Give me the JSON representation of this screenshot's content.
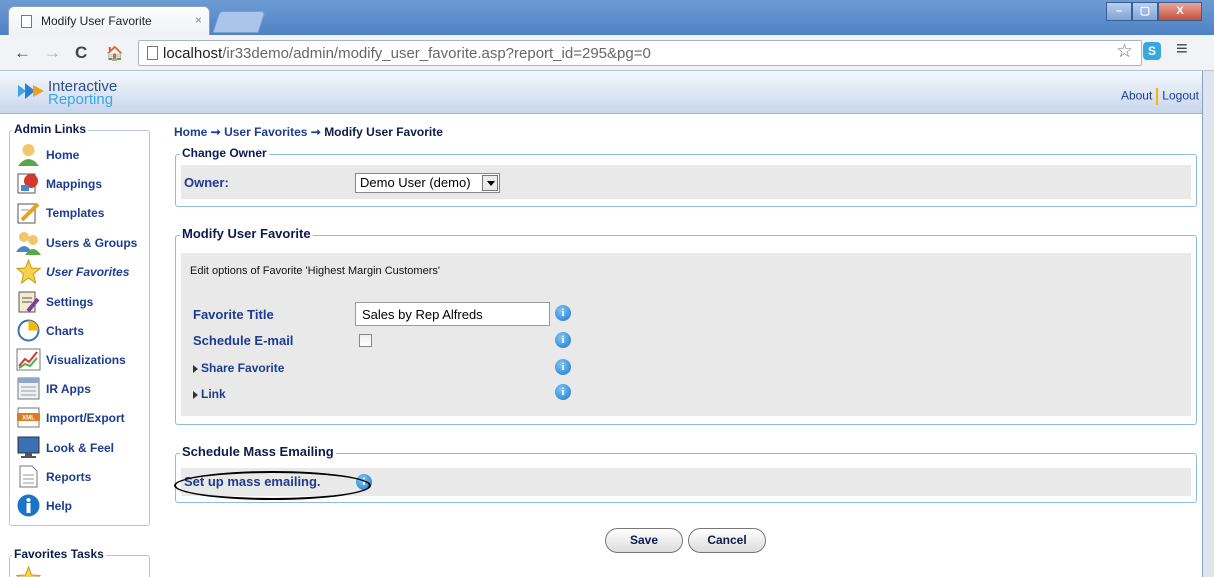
{
  "browser": {
    "tab_title": "Modify User Favorite",
    "tab_close": "×",
    "url_host": "localhost",
    "url_path": "/ir33demo/admin/modify_user_favorite.asp?report_id=295&pg=0",
    "back": "←",
    "forward": "→",
    "reload": "C",
    "home": "🏠",
    "star": "☆",
    "menu": "≡",
    "ext": "S",
    "win_min": "–",
    "win_max": "▢",
    "win_close": "X"
  },
  "header": {
    "brand_line1": "Interactive",
    "brand_line2": "Reporting",
    "about": "About",
    "logout": "Logout"
  },
  "sidebar": {
    "admin_links_title": "Admin Links",
    "items": [
      {
        "label": "Home",
        "icon": "user-icon"
      },
      {
        "label": "Mappings",
        "icon": "mappings-icon"
      },
      {
        "label": "Templates",
        "icon": "templates-icon"
      },
      {
        "label": "Users & Groups",
        "icon": "users-icon"
      },
      {
        "label": "User Favorites",
        "icon": "star-icon"
      },
      {
        "label": "Settings",
        "icon": "settings-icon"
      },
      {
        "label": "Charts",
        "icon": "pie-chart-icon"
      },
      {
        "label": "Visualizations",
        "icon": "line-chart-icon"
      },
      {
        "label": "IR Apps",
        "icon": "apps-icon"
      },
      {
        "label": "Import/Export",
        "icon": "xml-icon"
      },
      {
        "label": "Look & Feel",
        "icon": "monitor-icon"
      },
      {
        "label": "Reports",
        "icon": "document-icon"
      },
      {
        "label": "Help",
        "icon": "info-icon"
      }
    ],
    "favorites_tasks_title": "Favorites Tasks"
  },
  "breadcrumb": {
    "home": "Home",
    "sep1": " ➞ ",
    "user_favorites": "User Favorites",
    "sep2": " ➞ ",
    "current": "Modify User Favorite"
  },
  "change_owner": {
    "legend": "Change Owner",
    "owner_label": "Owner:",
    "owner_value": "Demo User (demo)"
  },
  "modify_favorite": {
    "legend": "Modify User Favorite",
    "description": "Edit options of Favorite 'Highest Margin Customers'",
    "title_label": "Favorite Title",
    "title_value": "Sales by Rep Alfreds",
    "schedule_label": "Schedule E-mail",
    "schedule_checked": false,
    "share_label": "Share Favorite",
    "link_label": "Link",
    "info": "i"
  },
  "mass_email": {
    "legend": "Schedule Mass Emailing",
    "link": "Set up mass emailing."
  },
  "actions": {
    "save": "Save",
    "cancel": "Cancel"
  },
  "colors": {
    "link_blue": "#1d3c8f",
    "panel_border": "#8fbcd8",
    "panel_fill": "#e9e9e9",
    "header_separator": "#f6b800"
  }
}
